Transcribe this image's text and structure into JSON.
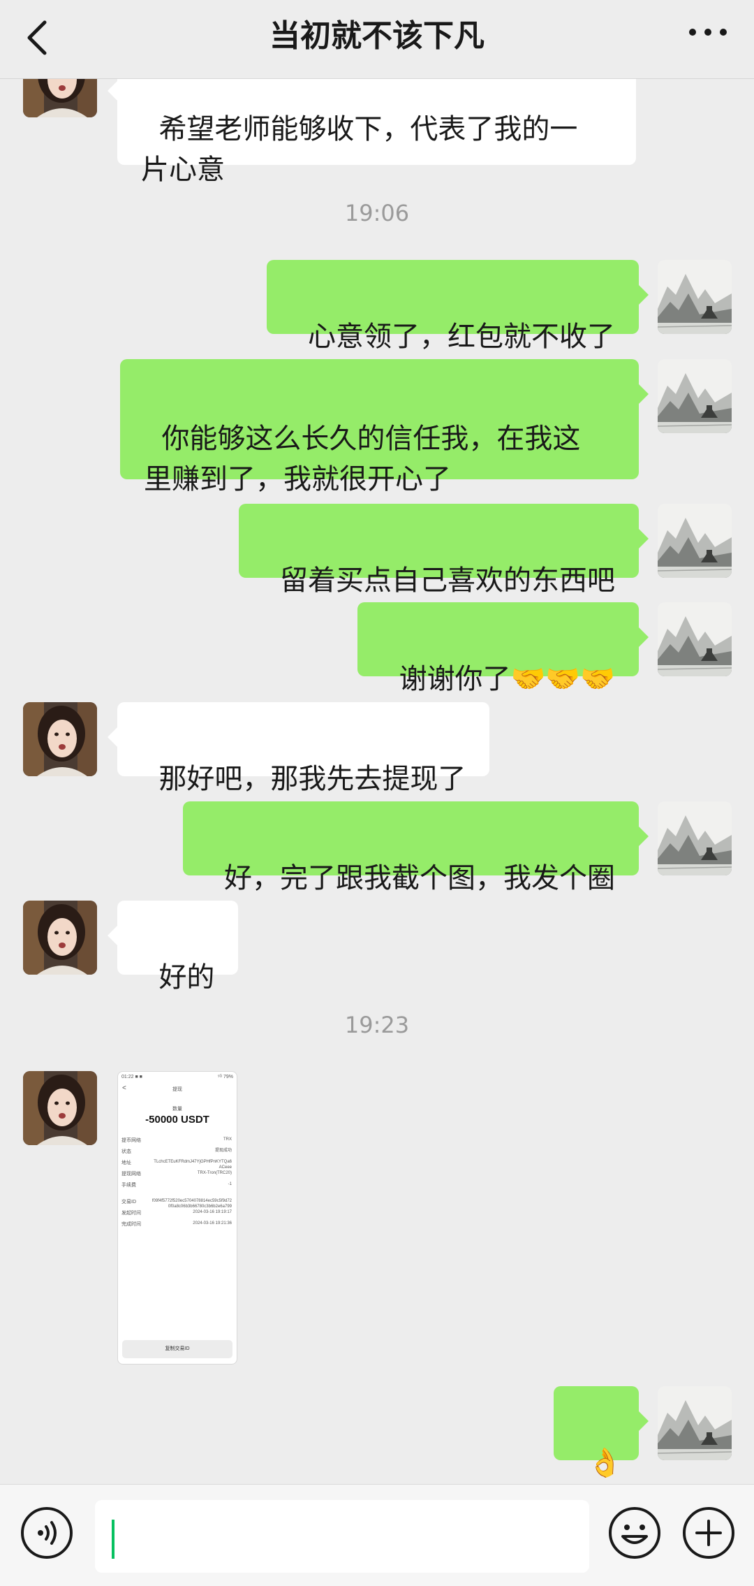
{
  "header": {
    "title": "当初就不该下凡"
  },
  "messages": [
    {
      "side": "in",
      "text": "希望老师能够收下，代表了我的一\n片心意"
    },
    {
      "time": "19:06"
    },
    {
      "side": "out",
      "text": "心意领了，红包就不收了"
    },
    {
      "side": "out",
      "text": "你能够这么长久的信任我，在我这\n里赚到了，我就很开心了"
    },
    {
      "side": "out",
      "text": "留着买点自己喜欢的东西吧"
    },
    {
      "side": "out",
      "text": "谢谢你了",
      "emoji": "🤝🤝🤝"
    },
    {
      "side": "in",
      "text": "那好吧，那我先去提现了"
    },
    {
      "side": "out",
      "text": "好，完了跟我截个图，我发个圈"
    },
    {
      "side": "in",
      "text": "好的"
    },
    {
      "time": "19:23"
    },
    {
      "side": "in",
      "type": "image"
    },
    {
      "side": "out",
      "emoji": "👌"
    }
  ],
  "image_card": {
    "status_time": "01:22 ■ ■",
    "status_right": "⁵ᴳ 79%",
    "back": "<",
    "page_title": "提现",
    "amount_label": "数量",
    "amount": "-50000 USDT",
    "rows": [
      {
        "k": "提币网络",
        "v": "TRX"
      },
      {
        "k": "状态",
        "v": "提现成功"
      },
      {
        "k": "地址",
        "v": "TLchcETEuKFRdmJ47YjGPHfPnKYTQa6ACeee"
      },
      {
        "k": "提现网络",
        "v": "TRX-Tron(TRC20)"
      },
      {
        "k": "手续费",
        "v": "-1"
      },
      {
        "k": "交易ID",
        "v": "f09f4f5772f520ec5704078814ec59c5f9d720f0a8c06b3b66780c3b6b2e6a799"
      },
      {
        "k": "发起时间",
        "v": "2024-03-16 19:19:17"
      },
      {
        "k": "完成时间",
        "v": "2024-03-16 19:21:36"
      }
    ],
    "copy_button": "复制交易ID"
  },
  "colors": {
    "background": "#ededed",
    "outgoing_bubble": "#95ec69",
    "incoming_bubble": "#ffffff",
    "cursor": "#07c160"
  }
}
